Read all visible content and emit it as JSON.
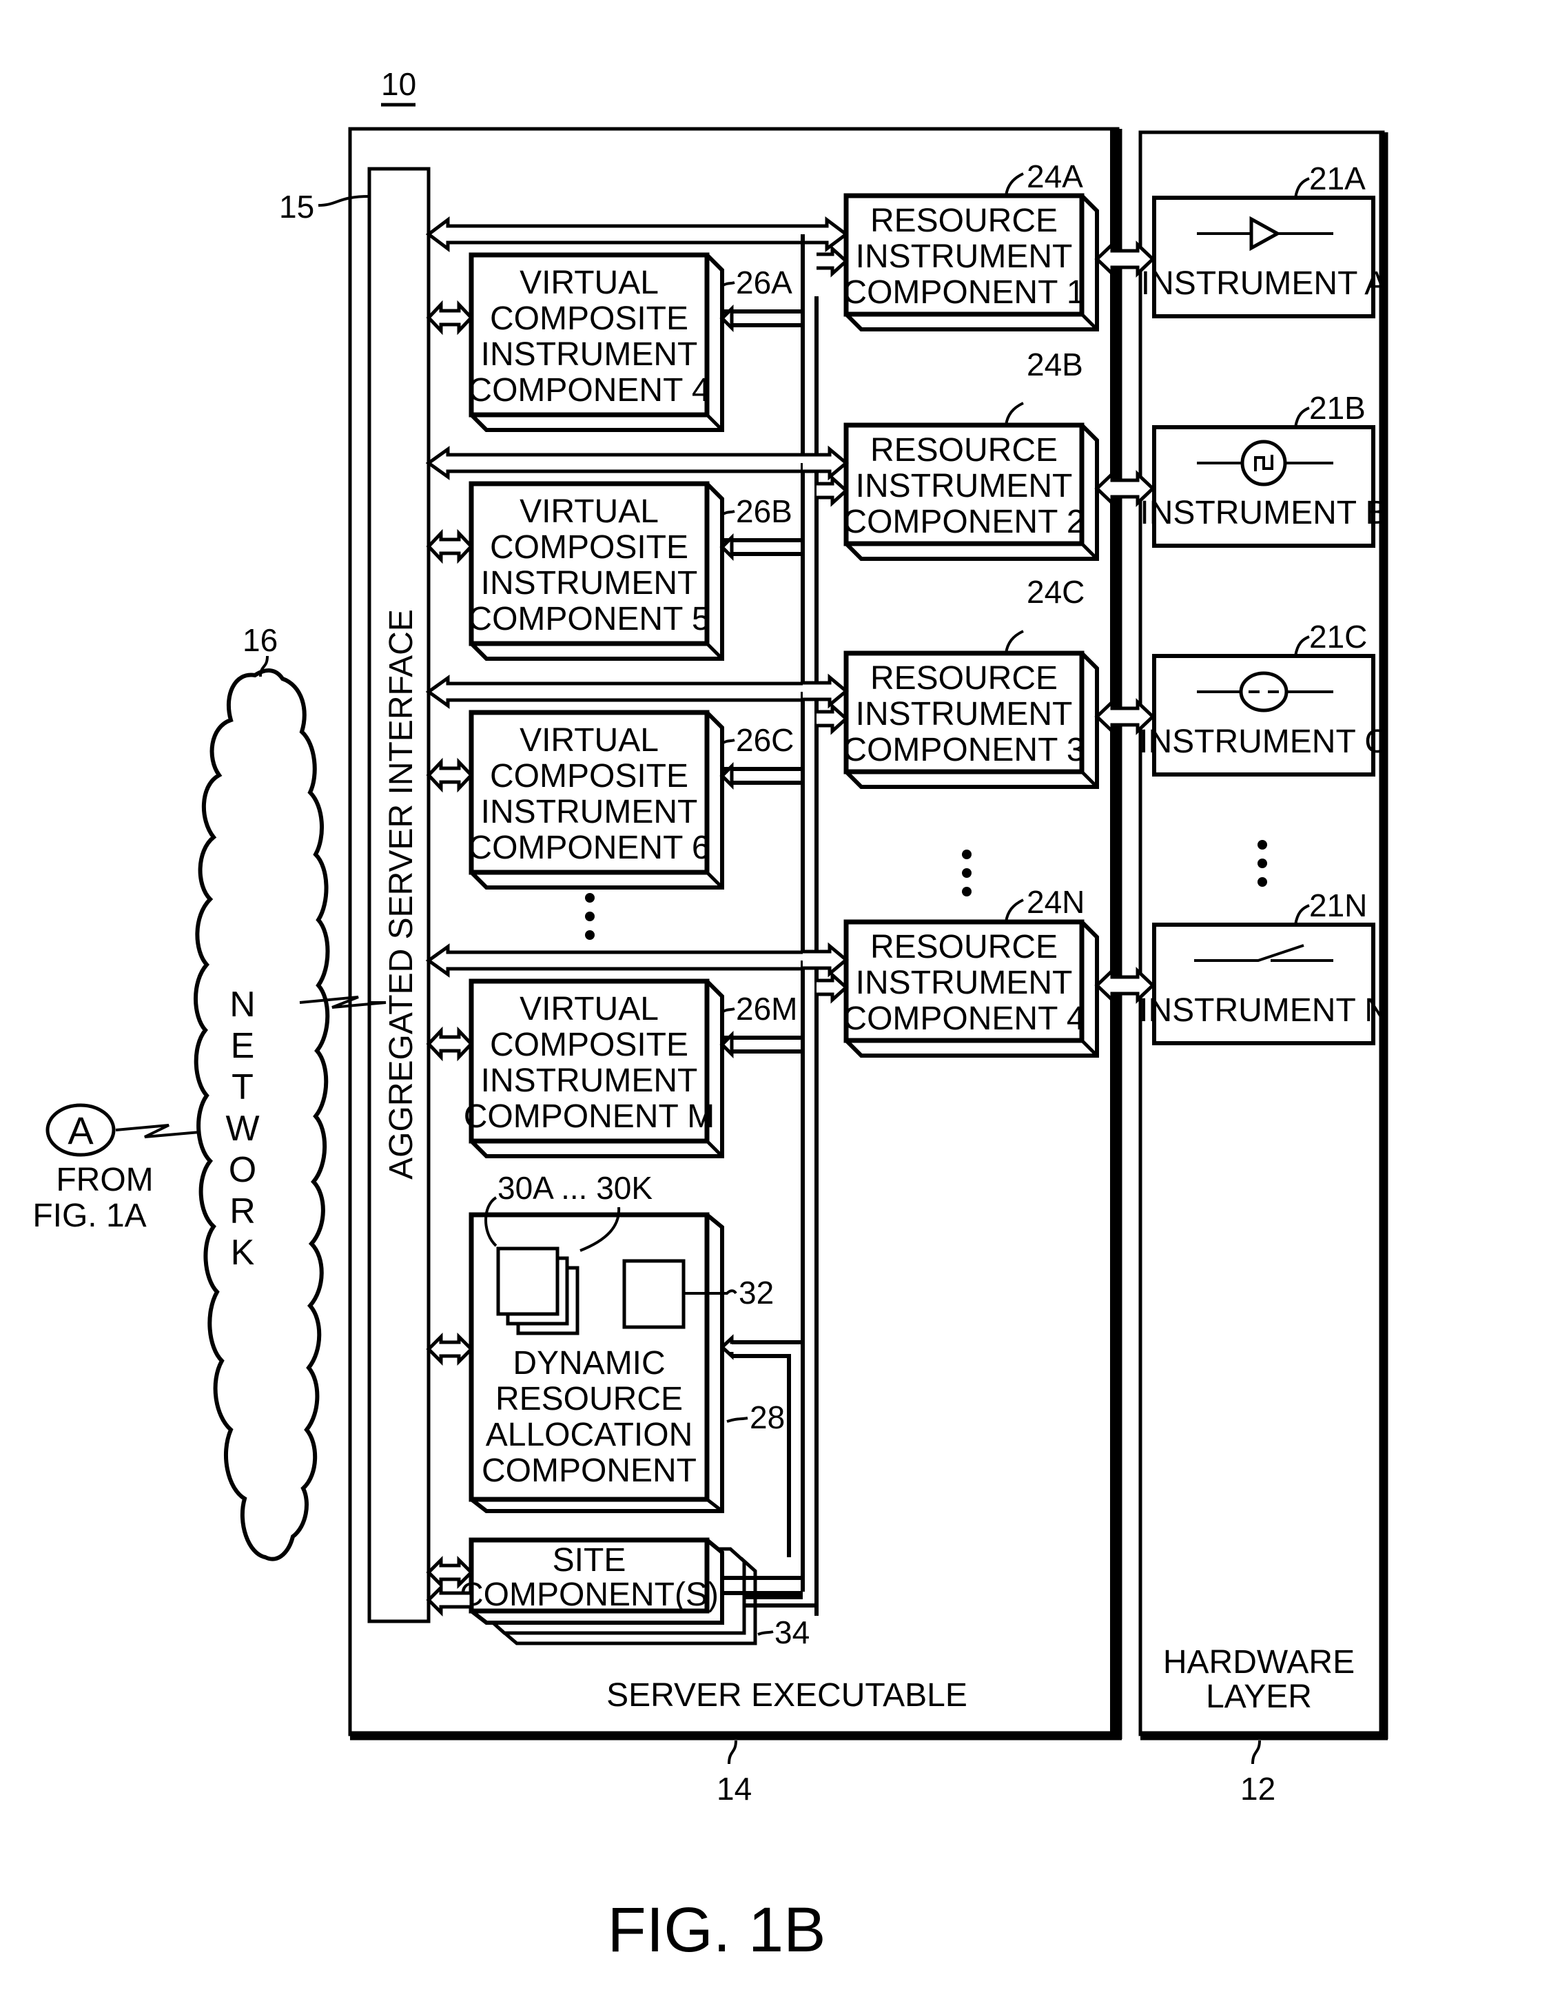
{
  "figure": {
    "caption": "FIG. 1B",
    "system_ref": "10"
  },
  "network": {
    "ref": "16",
    "letters": [
      "N",
      "E",
      "T",
      "W",
      "O",
      "R",
      "K"
    ]
  },
  "connector": {
    "letter": "A",
    "from_line1": "FROM",
    "from_line2": "FIG. 1A"
  },
  "server": {
    "ref": "14",
    "label": "SERVER EXECUTABLE",
    "interface_ref": "15",
    "interface_label": "AGGREGATED SERVER INTERFACE"
  },
  "virtual_components": [
    {
      "ref": "26A",
      "lines": [
        "VIRTUAL",
        "COMPOSITE",
        "INSTRUMENT",
        "COMPONENT 4"
      ]
    },
    {
      "ref": "26B",
      "lines": [
        "VIRTUAL",
        "COMPOSITE",
        "INSTRUMENT",
        "COMPONENT 5"
      ]
    },
    {
      "ref": "26C",
      "lines": [
        "VIRTUAL",
        "COMPOSITE",
        "INSTRUMENT",
        "COMPONENT 6"
      ]
    },
    {
      "ref": "26M",
      "lines": [
        "VIRTUAL",
        "COMPOSITE",
        "INSTRUMENT",
        "COMPONENT M"
      ]
    }
  ],
  "resource_components": [
    {
      "ref": "24A",
      "lines": [
        "RESOURCE",
        "INSTRUMENT",
        "COMPONENT 1"
      ]
    },
    {
      "ref": "24B",
      "lines": [
        "RESOURCE",
        "INSTRUMENT",
        "COMPONENT 2"
      ]
    },
    {
      "ref": "24C",
      "lines": [
        "RESOURCE",
        "INSTRUMENT",
        "COMPONENT 3"
      ]
    },
    {
      "ref": "24N",
      "lines": [
        "RESOURCE",
        "INSTRUMENT",
        "COMPONENT 4"
      ]
    }
  ],
  "dynamic_allocation": {
    "ref": "28",
    "lines": [
      "DYNAMIC",
      "RESOURCE",
      "ALLOCATION",
      "COMPONENT"
    ],
    "docs_ref": "30A ... 30K",
    "inner_ref": "32"
  },
  "site": {
    "ref": "34",
    "lines": [
      "SITE",
      "COMPONENT(S)"
    ]
  },
  "hardware": {
    "ref": "12",
    "lines": [
      "HARDWARE",
      "LAYER"
    ],
    "instruments": [
      {
        "ref": "21A",
        "label": "INSTRUMENT A",
        "icon": "amplifier-icon"
      },
      {
        "ref": "21B",
        "label": "INSTRUMENT B",
        "icon": "signal-generator-icon"
      },
      {
        "ref": "21C",
        "label": "INSTRUMENT C",
        "icon": "meter-icon"
      },
      {
        "ref": "21N",
        "label": "INSTRUMENT N",
        "icon": "switch-icon"
      }
    ]
  }
}
